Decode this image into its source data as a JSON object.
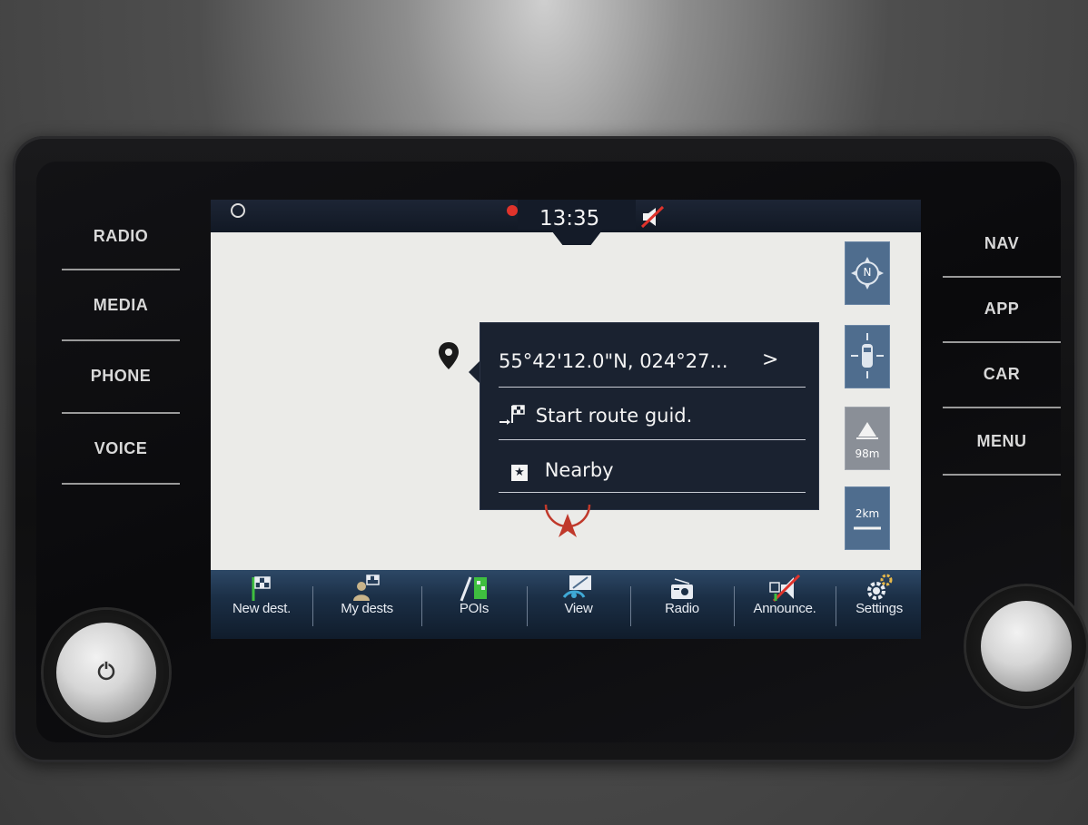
{
  "hardware_buttons": {
    "left": [
      "RADIO",
      "MEDIA",
      "PHONE",
      "VOICE"
    ],
    "right": [
      "NAV",
      "APP",
      "CAR",
      "MENU"
    ]
  },
  "status_bar": {
    "time": "13:35",
    "icons": [
      "compass-circle-icon",
      "gps-dot-icon",
      "mute-icon"
    ]
  },
  "popup": {
    "coordinates": "55°42'12.0\"N, 024°27...",
    "coordinates_chevron": ">",
    "start_route": "Start route guid.",
    "nearby": "Nearby"
  },
  "map_controls": {
    "north_label": "N",
    "elevation": "98m",
    "scale": "2km"
  },
  "bottom_bar": {
    "items": [
      "New dest.",
      "My dests",
      "POIs",
      "View",
      "Radio",
      "Announce.",
      "Settings"
    ]
  },
  "colors": {
    "screen_bg": "#ebebe8",
    "popup_bg": "#1a2230",
    "control_blue": "#4f6d8e",
    "gps_red": "#e0332b"
  }
}
